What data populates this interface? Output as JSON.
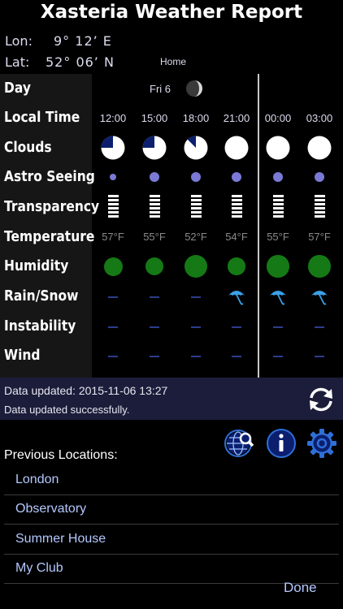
{
  "app": {
    "title": "Xasteria Weather Report"
  },
  "location": {
    "lon_label": "Lon:",
    "lon_value": "9° 12’ E",
    "lat_label": "Lat:",
    "lat_value": "52° 06’ N",
    "name": "Home"
  },
  "rows": {
    "day": "Day",
    "local_time": "Local Time",
    "clouds": "Clouds",
    "astro_seeing": "Astro Seeing",
    "transparency": "Transparency",
    "temperature": "Temperature",
    "humidity": "Humidity",
    "rain_snow": "Rain/Snow",
    "instability": "Instability",
    "wind": "Wind"
  },
  "forecast": {
    "day": "Fri 6",
    "moon_icon": "moon-phase-icon",
    "columns": [
      {
        "time": "12:00",
        "cloud_cover": 0.25,
        "seeing": 1,
        "transparency_bars": 6,
        "temperature": "57°F",
        "humidity": 0.55,
        "rain": false
      },
      {
        "time": "15:00",
        "cloud_cover": 0.25,
        "seeing": 2,
        "transparency_bars": 6,
        "temperature": "55°F",
        "humidity": 0.5,
        "rain": false
      },
      {
        "time": "18:00",
        "cloud_cover": 0.125,
        "seeing": 2,
        "transparency_bars": 6,
        "temperature": "52°F",
        "humidity": 0.8,
        "rain": false
      },
      {
        "time": "21:00",
        "cloud_cover": 0,
        "seeing": 2,
        "transparency_bars": 6,
        "temperature": "54°F",
        "humidity": 0.48,
        "rain": true
      },
      {
        "time": "00:00",
        "cloud_cover": 0,
        "seeing": 2,
        "transparency_bars": 6,
        "temperature": "55°F",
        "humidity": 0.78,
        "rain": true
      },
      {
        "time": "03:00",
        "cloud_cover": 0,
        "seeing": 2,
        "transparency_bars": 6,
        "temperature": "57°F",
        "humidity": 0.78,
        "rain": true
      }
    ]
  },
  "status": {
    "updated": "Data updated: 2015-11-06 13:27",
    "message": "Data updated successfully."
  },
  "previous": {
    "label": "Previous Locations:",
    "items": [
      "London",
      "Observatory",
      "Summer House",
      "My Club"
    ]
  },
  "actions": {
    "done": "Done"
  },
  "colors": {
    "accent": "#b4c8ff",
    "cloud_dark": "#0b1f6e",
    "humidity": "#157a15",
    "seeing": "#7a7ad6",
    "rain": "#3aa0e8"
  }
}
